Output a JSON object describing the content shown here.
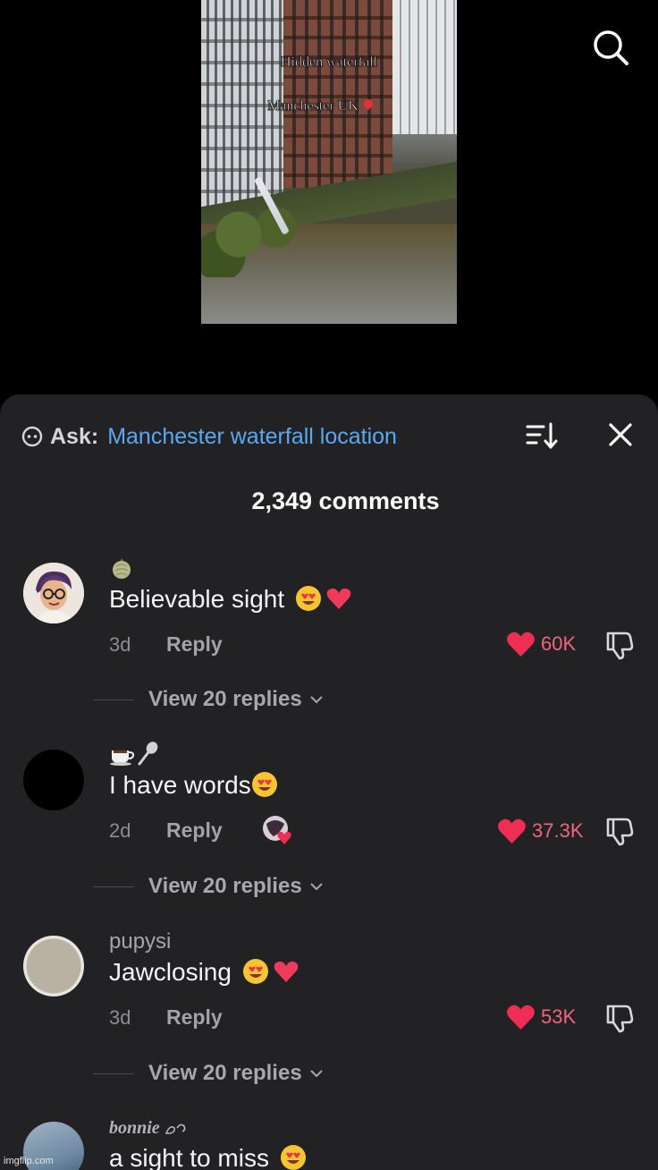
{
  "video": {
    "overlay_line1": "Hidden waterfall",
    "overlay_line2": "Manchester UK"
  },
  "header": {
    "ask_label": "Ask:",
    "ask_query": "Manchester waterfall location",
    "comment_count": "2,349 comments"
  },
  "comments": [
    {
      "username": "",
      "text": "Believable sight",
      "time": "3d",
      "reply_label": "Reply",
      "likes": "60K",
      "view_replies": "View 20 replies"
    },
    {
      "username": "",
      "text": "I have words",
      "time": "2d",
      "reply_label": "Reply",
      "likes": "37.3K",
      "view_replies": "View 20 replies"
    },
    {
      "username": "pupysi",
      "text": "Jawclosing",
      "time": "3d",
      "reply_label": "Reply",
      "likes": "53K",
      "view_replies": "View 20 replies"
    },
    {
      "username": "bonnie",
      "text": "a sight to miss"
    }
  ],
  "watermark": "imgflip.com",
  "colors": {
    "sheet_bg": "#222225",
    "accent_link": "#5aa9f0",
    "like_red": "#f0647e"
  }
}
